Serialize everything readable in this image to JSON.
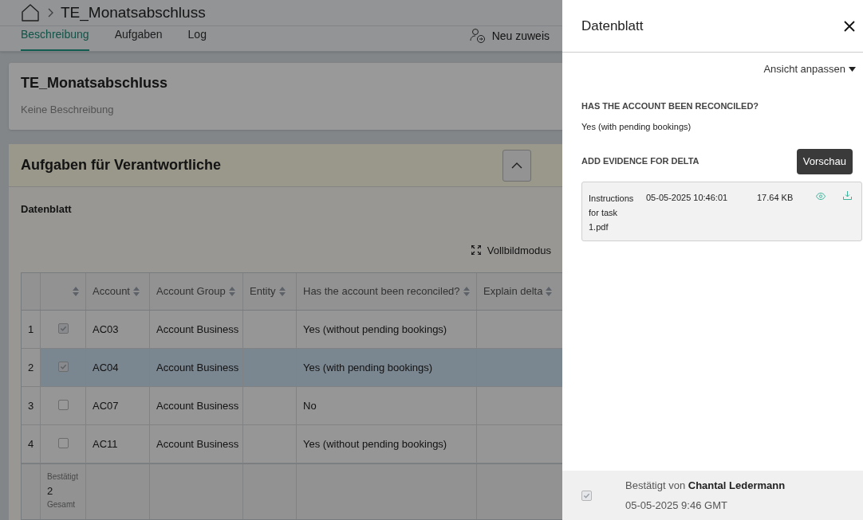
{
  "breadcrumb": {
    "title": "TE_Monatsabschluss"
  },
  "tabs": [
    {
      "label": "Beschreibung",
      "selected": true
    },
    {
      "label": "Aufgaben",
      "selected": false
    },
    {
      "label": "Log",
      "selected": false
    }
  ],
  "reassign_button": "Neu zuweis",
  "description_card": {
    "title": "TE_Monatsabschluss",
    "description": "Keine Beschreibung"
  },
  "section": {
    "title": "Aufgaben für Verantwortliche",
    "subtitle": "Datenblatt",
    "fullscreen": "Vollbildmodus"
  },
  "table": {
    "columns": [
      "Account",
      "Account Group",
      "Entity",
      "Has the account been reconciled?",
      "Explain delta"
    ],
    "rows": [
      {
        "index": "1",
        "checked": true,
        "selected": false,
        "cells": [
          "AC03",
          "Account Business",
          "",
          "Yes (without pending bookings)",
          ""
        ]
      },
      {
        "index": "2",
        "checked": true,
        "selected": true,
        "cells": [
          "AC04",
          "Account Business",
          "",
          "Yes (with pending bookings)",
          ""
        ]
      },
      {
        "index": "3",
        "checked": false,
        "selected": false,
        "cells": [
          "AC07",
          "Account Business",
          "",
          "No",
          ""
        ]
      },
      {
        "index": "4",
        "checked": false,
        "selected": false,
        "cells": [
          "AC11",
          "Account Business",
          "",
          "Yes (without pending bookings)",
          ""
        ]
      }
    ],
    "footer": {
      "label": "Bestätigt",
      "value": "2",
      "label_2": "Gesamt"
    }
  },
  "panel": {
    "title": "Datenblatt",
    "view_button": "Ansicht anpassen",
    "fields": [
      {
        "label": "HAS THE ACCOUNT BEEN RECONCILED?",
        "value": "Yes (with pending bookings)"
      }
    ],
    "evidence": {
      "label": "ADD EVIDENCE FOR DELTA",
      "file": {
        "name": "Instructions for task 1.pdf",
        "date": "05-05-2025 10:46:01",
        "size": "17.64 KB"
      },
      "tooltip": "Vorschau"
    },
    "confirmation": {
      "checked": true,
      "text": "Bestätigt von **Chantal Ledermann**",
      "time": "05-05-2025 9:46 GMT"
    }
  }
}
